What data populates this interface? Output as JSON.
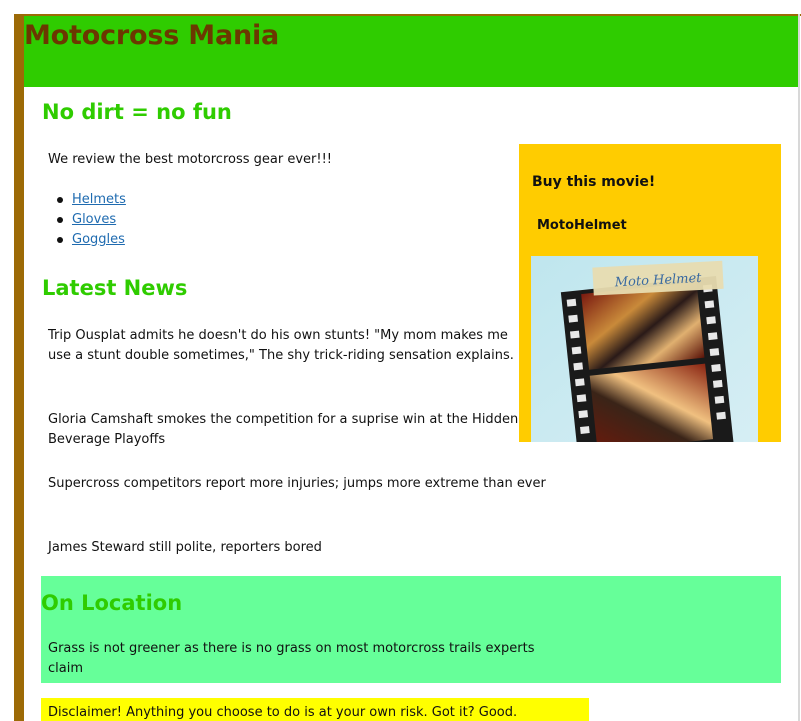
{
  "site": {
    "title": "Motocross Mania"
  },
  "main": {
    "heading": "No dirt = no fun",
    "intro": "We review the best motorcross gear ever!!!",
    "nav_links": [
      {
        "label": "Helmets"
      },
      {
        "label": "Gloves"
      },
      {
        "label": "Goggles"
      }
    ]
  },
  "news": {
    "heading": "Latest News",
    "items": [
      "Trip Ousplat admits he doesn't do his own stunts! \"My mom makes me use a stunt double sometimes,\" The shy trick-riding sensation explains.",
      "Gloria Camshaft smokes the competition for a suprise win at the Hidden Beverage Playoffs",
      "Supercross competitors report more injuries; jumps more extreme than ever",
      "James Steward still polite, reporters bored"
    ]
  },
  "sidebar": {
    "heading": "Buy this movie!",
    "product_name": "MotoHelmet",
    "poster_caption": "Moto Helmet"
  },
  "location": {
    "heading": "On Location",
    "text": "Grass is not greener as there is no grass on most motorcross trails experts claim"
  },
  "footer": {
    "disclaimer": "Disclaimer! Anything you choose to do is at your own risk. Got it? Good."
  },
  "colors": {
    "header_bg": "#2fcc00",
    "title": "#6b3800",
    "heading_green": "#2fcc00",
    "sidebar_bg": "#ffcc00",
    "location_bg": "#66ff99",
    "disclaimer_bg": "#ffff00",
    "left_border": "#9c6a06",
    "link": "#1f6bb0"
  }
}
